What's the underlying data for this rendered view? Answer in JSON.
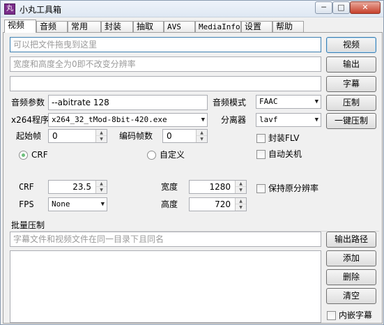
{
  "window": {
    "title": "小丸工具箱",
    "app_icon_glyph": "丸"
  },
  "tabs": [
    "视频",
    "音频",
    "常用",
    "封装",
    "抽取",
    "AVS",
    "MediaInfo",
    "设置",
    "帮助"
  ],
  "video": {
    "drop_placeholder": "可以把文件拖曳到这里",
    "size_placeholder": "宽度和高度全为0即不改变分辨率",
    "subtitle_value": "",
    "buttons": {
      "video": "视频",
      "output": "输出",
      "subtitle": "字幕",
      "compress": "压制",
      "one_click": "一键压制"
    },
    "audio_params_label": "音频参数",
    "audio_params_value": "--abitrate 128",
    "audio_mode_label": "音频模式",
    "audio_mode_value": "FAAC",
    "x264_label": "x264程序",
    "x264_value": "x264_32_tMod-8bit-420.exe",
    "splitter_label": "分离器",
    "splitter_value": "lavf",
    "start_frame_label": "起始帧",
    "start_frame_value": "0",
    "encode_frames_label": "编码帧数",
    "encode_frames_value": "0",
    "mux_flv_label": "封装FLV",
    "auto_shutdown_label": "自动关机",
    "crf_radio_label": "CRF",
    "custom_radio_label": "自定义",
    "crf_label": "CRF",
    "crf_value": "23.5",
    "fps_label": "FPS",
    "fps_value": "None",
    "width_label": "宽度",
    "width_value": "1280",
    "height_label": "高度",
    "height_value": "720",
    "keep_res_label": "保持原分辨率"
  },
  "batch": {
    "title": "批量压制",
    "placeholder": "字幕文件和视频文件在同一目录下且同名",
    "buttons": {
      "output_path": "输出路径",
      "add": "添加",
      "delete": "删除",
      "clear": "清空"
    },
    "embed_subtitle_label": "内嵌字幕"
  }
}
